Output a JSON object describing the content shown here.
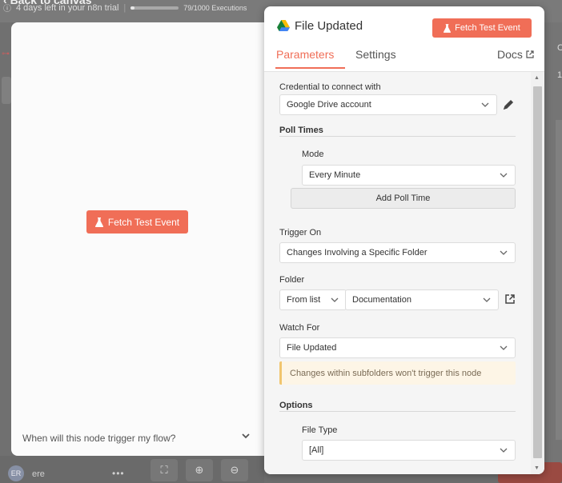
{
  "background": {
    "back_label": "Back to canvas",
    "trial_text": "4 days left in your n8n trial",
    "executions": "79/1000 Executions",
    "executions_fraction": 0.079,
    "avatar_initials": "ER",
    "user_name": "ere",
    "dots": "•••",
    "right_c": "C",
    "right_one": "1"
  },
  "input_panel": {
    "fetch_button": "Fetch Test Event",
    "when_text": "When will this node trigger my flow?"
  },
  "node": {
    "title": "File Updated",
    "fetch_button": "Fetch Test Event",
    "tabs": {
      "parameters": "Parameters",
      "settings": "Settings",
      "docs": "Docs"
    }
  },
  "params": {
    "credential_label": "Credential to connect with",
    "credential_value": "Google Drive account",
    "poll_times_title": "Poll Times",
    "mode_label": "Mode",
    "mode_value": "Every Minute",
    "add_poll_button": "Add Poll Time",
    "trigger_on_label": "Trigger On",
    "trigger_on_value": "Changes Involving a Specific Folder",
    "folder_label": "Folder",
    "folder_source": "From list",
    "folder_value": "Documentation",
    "watch_for_label": "Watch For",
    "watch_for_value": "File Updated",
    "notice_text": "Changes within subfolders won't trigger this node",
    "options_title": "Options",
    "file_type_label": "File Type",
    "file_type_value": "[All]"
  },
  "colors": {
    "accent": "#f06e57",
    "notice_border": "#f1c56e",
    "notice_bg": "#fdf5e6"
  }
}
